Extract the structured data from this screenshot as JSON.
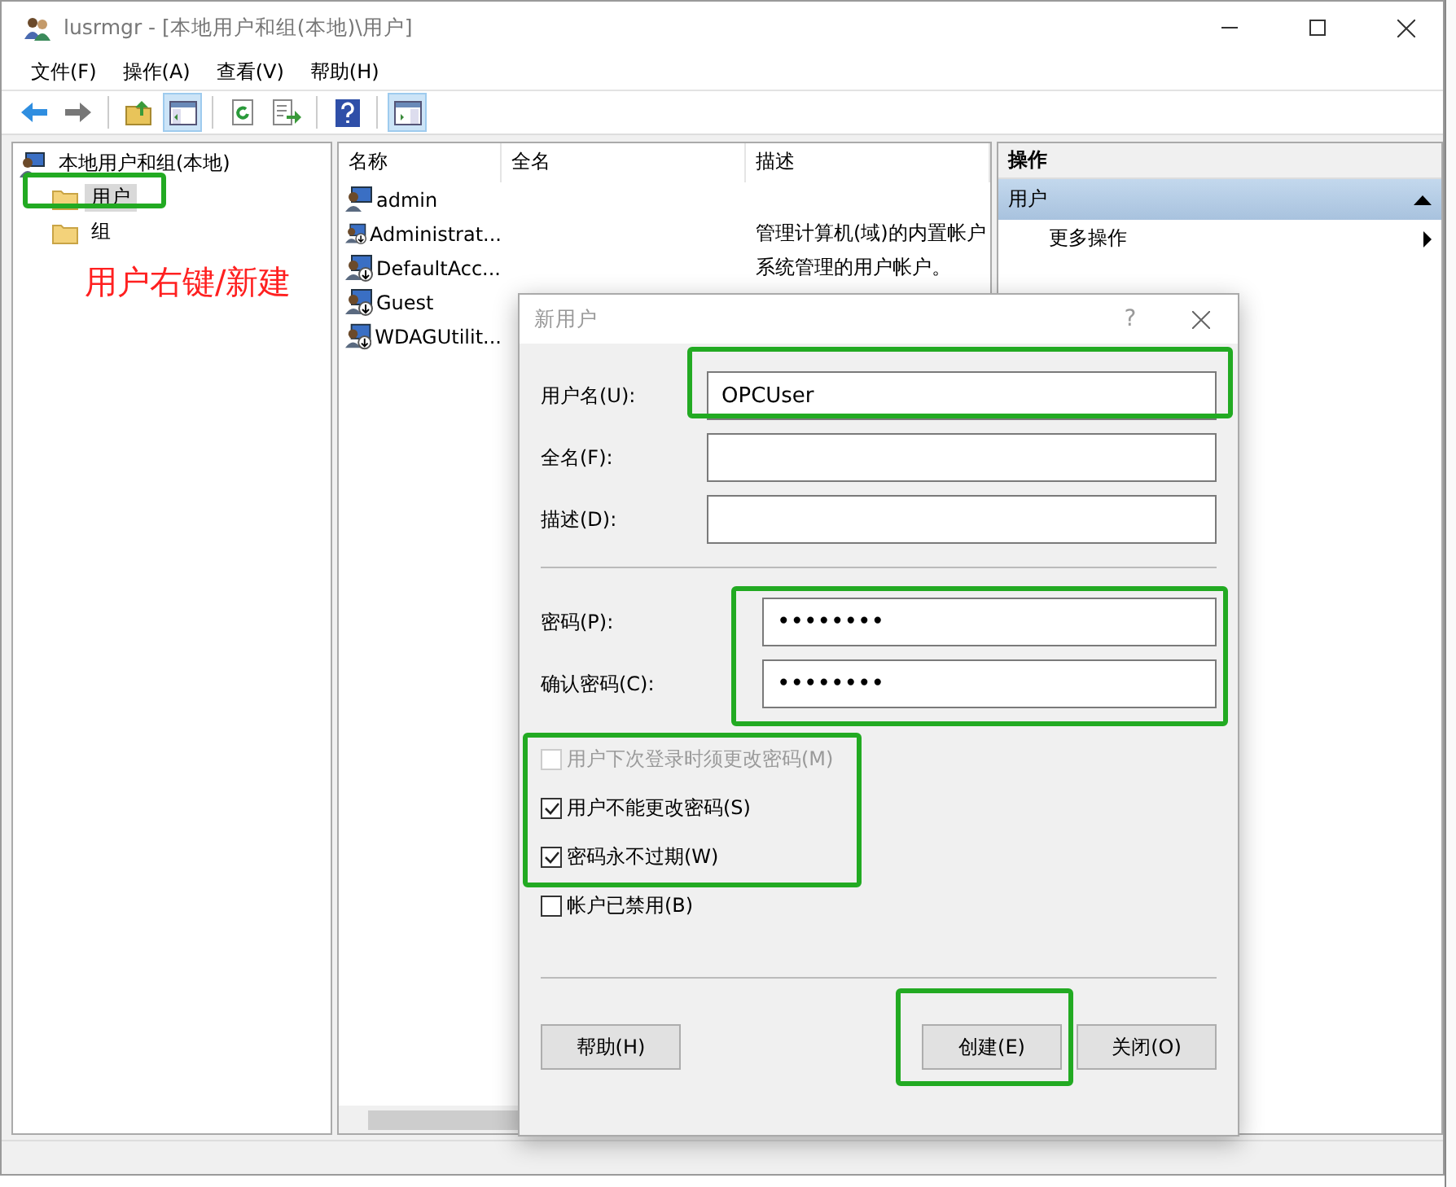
{
  "window": {
    "title": "lusrmgr - [本地用户和组(本地)\\用户]"
  },
  "menu": [
    "文件(F)",
    "操作(A)",
    "查看(V)",
    "帮助(H)"
  ],
  "toolbar": [
    {
      "kind": "back",
      "pressed": false
    },
    {
      "kind": "forward",
      "pressed": false
    },
    {
      "kind": "up",
      "pressed": false
    },
    {
      "kind": "tree",
      "pressed": true
    },
    {
      "kind": "refresh",
      "pressed": false
    },
    {
      "kind": "export",
      "pressed": false
    },
    {
      "kind": "help",
      "pressed": false
    },
    {
      "kind": "action-pane",
      "pressed": true
    }
  ],
  "tree": {
    "label": "本地用户和组(本地)",
    "children": [
      {
        "label": "用户",
        "selected": true
      },
      {
        "label": "组",
        "selected": false
      }
    ]
  },
  "annotation": "用户右键/新建",
  "list": {
    "columns": [
      "名称",
      "全名",
      "描述"
    ],
    "rows": [
      {
        "name": "admin",
        "disabled": false
      },
      {
        "name": "Administrat...",
        "description": "管理计算机(域)的内置帐户",
        "disabled": true
      },
      {
        "name": "DefaultAcc...",
        "description": "系统管理的用户帐户。",
        "disabled": true
      },
      {
        "name": "Guest",
        "disabled": true
      },
      {
        "name": "WDAGUtilit...",
        "disabled": true
      }
    ]
  },
  "actions": {
    "title": "操作",
    "section": "用户",
    "items": [
      "更多操作"
    ]
  },
  "dialog": {
    "title": "新用户",
    "help": "?",
    "fields": [
      {
        "label": "用户名(U):",
        "value": "OPCUser",
        "kind": "text"
      },
      {
        "label": "全名(F):",
        "kind": "text"
      },
      {
        "label": "描述(D):",
        "kind": "text"
      },
      {
        "label": "密码(P):",
        "value": "••••••••",
        "kind": "password"
      },
      {
        "label": "确认密码(C):",
        "value": "••••••••",
        "kind": "password"
      }
    ],
    "checkboxes": [
      {
        "label": "用户下次登录时须更改密码(M)",
        "checked": false,
        "disabled": true
      },
      {
        "label": "用户不能更改密码(S)",
        "checked": true,
        "disabled": false
      },
      {
        "label": "密码永不过期(W)",
        "checked": true,
        "disabled": false
      },
      {
        "label": "帐户已禁用(B)",
        "checked": false,
        "disabled": false
      }
    ],
    "buttons": [
      {
        "label": "帮助(H)",
        "kind": "left"
      },
      {
        "label": "创建(E)",
        "kind": "right"
      },
      {
        "label": "关闭(O)",
        "kind": "right"
      }
    ]
  }
}
